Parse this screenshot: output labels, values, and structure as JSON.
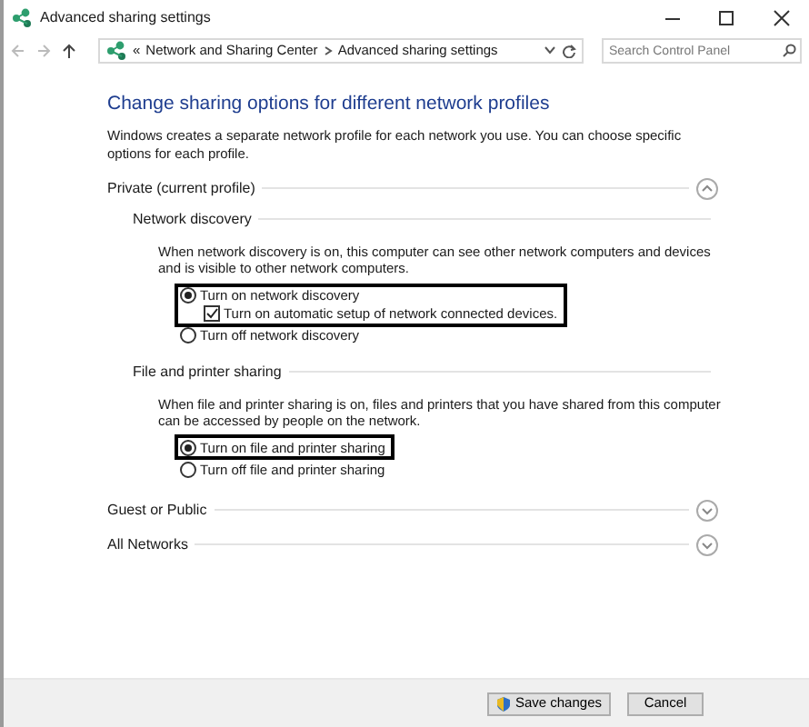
{
  "window": {
    "title": "Advanced sharing settings"
  },
  "address_bar": {
    "overflow": "«",
    "breadcrumbs": [
      "Network and Sharing Center",
      "Advanced sharing settings"
    ]
  },
  "search": {
    "placeholder": "Search Control Panel"
  },
  "heading": "Change sharing options for different network profiles",
  "intro": "Windows creates a separate network profile for each network you use. You can choose specific options for each profile.",
  "profiles": [
    {
      "label": "Private (current profile)",
      "expanded": true,
      "sections": [
        {
          "title": "Network discovery",
          "description": "When network discovery is on, this computer can see other network computers and devices and is visible to other network computers.",
          "options": [
            {
              "kind": "radio",
              "label": "Turn on network discovery",
              "selected": true,
              "highlighted": true,
              "children": [
                {
                  "kind": "checkbox",
                  "label": "Turn on automatic setup of network connected devices.",
                  "checked": true
                }
              ]
            },
            {
              "kind": "radio",
              "label": "Turn off network discovery",
              "selected": false,
              "highlighted": false
            }
          ]
        },
        {
          "title": "File and printer sharing",
          "description": "When file and printer sharing is on, files and printers that you have shared from this computer can be accessed by people on the network.",
          "options": [
            {
              "kind": "radio",
              "label": "Turn on file and printer sharing",
              "selected": true,
              "highlighted": true
            },
            {
              "kind": "radio",
              "label": "Turn off file and printer sharing",
              "selected": false,
              "highlighted": false
            }
          ]
        }
      ]
    },
    {
      "label": "Guest or Public",
      "expanded": false
    },
    {
      "label": "All Networks",
      "expanded": false
    }
  ],
  "buttons": [
    {
      "label": "Save changes",
      "kind": "elevated"
    },
    {
      "label": "Cancel",
      "kind": "plain"
    }
  ]
}
